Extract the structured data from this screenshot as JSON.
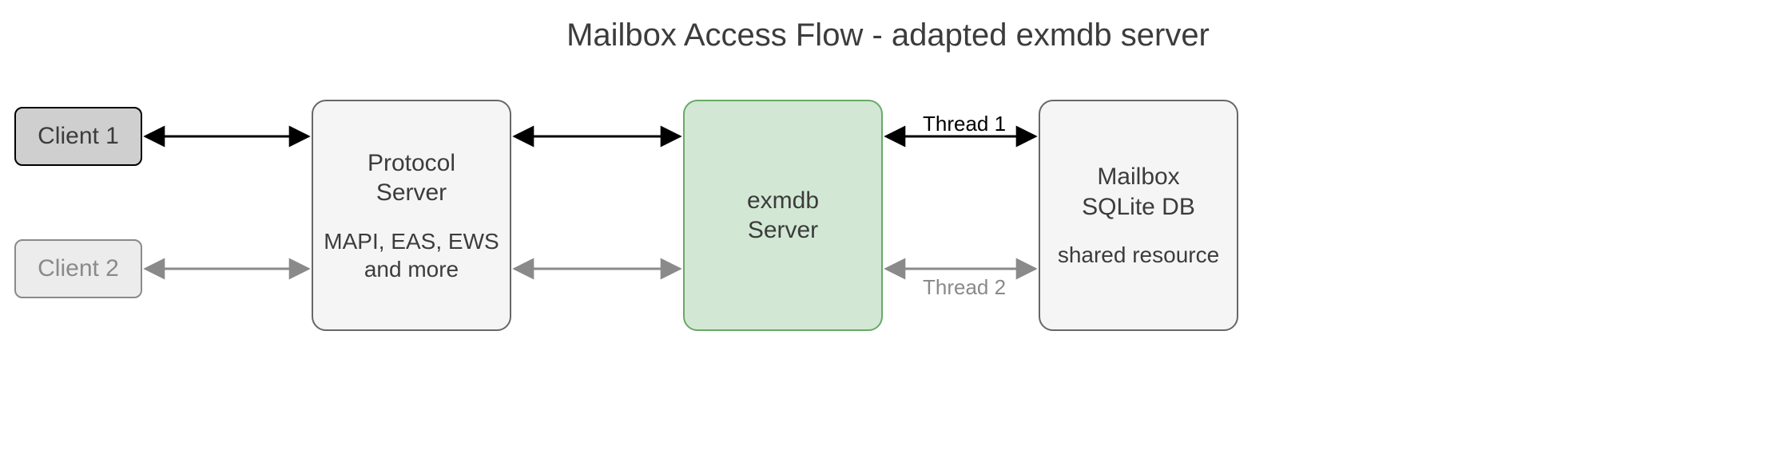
{
  "title": "Mailbox Access Flow - adapted exmdb server",
  "nodes": {
    "client1": {
      "label": "Client 1"
    },
    "client2": {
      "label": "Client 2"
    },
    "protocol": {
      "line1": "Protocol",
      "line2": "Server",
      "sub1": "MAPI, EAS, EWS",
      "sub2": "and more"
    },
    "exmdb": {
      "line1": "exmdb",
      "line2": "Server"
    },
    "mailbox": {
      "line1": "Mailbox",
      "line2": "SQLite DB",
      "sub1": "shared resource"
    }
  },
  "edges": {
    "thread1": {
      "label": "Thread 1"
    },
    "thread2": {
      "label": "Thread 2"
    }
  },
  "colors": {
    "client1_fill": "#cfcfcf",
    "client2_fill": "#ececec",
    "protocol_fill": "#f5f5f5",
    "exmdb_fill": "#d2e8d4",
    "exmdb_stroke": "#68a968",
    "mailbox_fill": "#f5f5f5",
    "stroke_dark": "#000000",
    "stroke_gray": "#8a8a8a",
    "text_gray": "#8a8a8a"
  }
}
